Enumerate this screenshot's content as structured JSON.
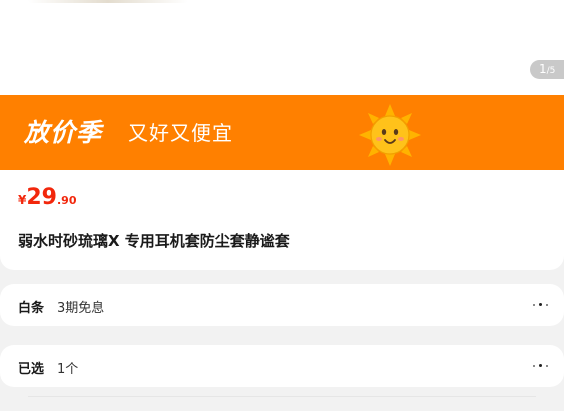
{
  "gallery": {
    "page_current": "1",
    "page_total": "/5"
  },
  "promo": {
    "logo_text": "放价季",
    "slogan": "又好又便宜",
    "mascot_icon": "sun-mascot-icon",
    "background_color": "#ff8000"
  },
  "product": {
    "price_currency": "¥",
    "price_integer": "29",
    "price_decimal": ".90",
    "price_color": "#f2270c",
    "title": "弱水时砂琉璃X 专用耳机套防尘套静谧套"
  },
  "baitiao": {
    "label": "白条",
    "value": "3期免息",
    "more_icon": "more-dots-icon"
  },
  "selected": {
    "label": "已选",
    "value": "1个",
    "more_icon": "more-dots-icon"
  }
}
